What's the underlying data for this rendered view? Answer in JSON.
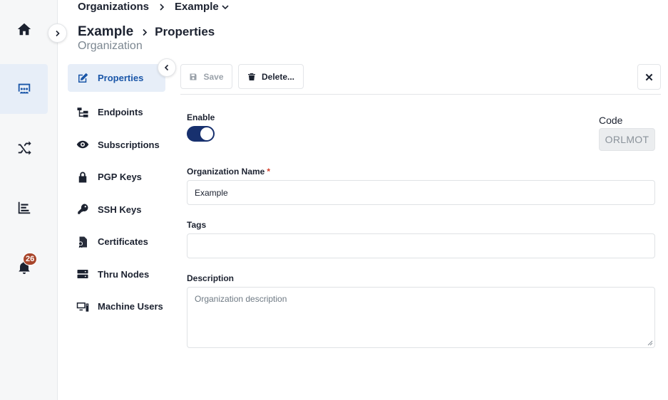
{
  "breadcrumb": {
    "root": "Organizations",
    "current": "Example"
  },
  "header": {
    "title": "Example",
    "section": "Properties",
    "subtitle": "Organization"
  },
  "rail": {
    "items": [
      {
        "icon": "home-icon"
      },
      {
        "icon": "organization-icon",
        "active": true
      },
      {
        "icon": "shuffle-icon"
      },
      {
        "icon": "bar-chart-icon"
      },
      {
        "icon": "bell-icon"
      }
    ],
    "notification_count": "26"
  },
  "section_nav": {
    "items": [
      {
        "label": "Properties",
        "icon": "edit-icon"
      },
      {
        "label": "Endpoints",
        "icon": "hierarchy-icon"
      },
      {
        "label": "Subscriptions",
        "icon": "eye-icon"
      },
      {
        "label": "PGP Keys",
        "icon": "lock-icon"
      },
      {
        "label": "SSH Keys",
        "icon": "key-icon"
      },
      {
        "label": "Certificates",
        "icon": "certificate-icon"
      },
      {
        "label": "Thru Nodes",
        "icon": "server-icon"
      },
      {
        "label": "Machine Users",
        "icon": "computer-icon"
      }
    ]
  },
  "toolbar": {
    "save_label": "Save",
    "delete_label": "Delete..."
  },
  "form": {
    "enable_label": "Enable",
    "enabled": true,
    "code_label": "Code",
    "code_value": "ORLMOT",
    "org_name_label": "Organization Name",
    "required_mark": "*",
    "org_name_value": "Example",
    "tags_label": "Tags",
    "tags_value": "",
    "description_label": "Description",
    "description_placeholder": "Organization description"
  },
  "colors": {
    "accent": "#1a56a8",
    "toggle_on": "#17306e",
    "badge": "#a8462c",
    "active_bg": "#e7eef8"
  }
}
